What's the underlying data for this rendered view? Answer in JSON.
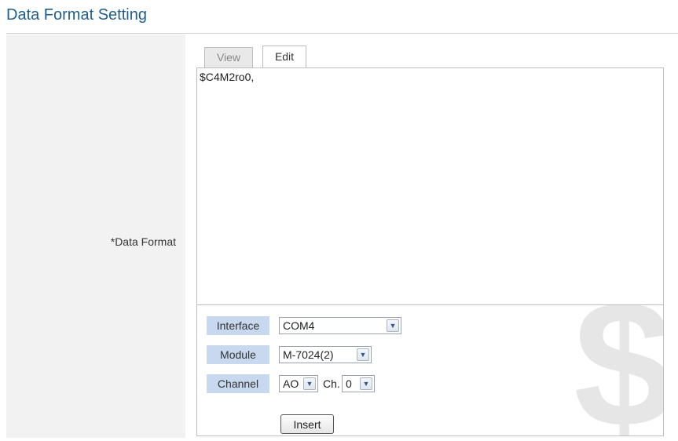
{
  "page": {
    "title": "Data Format Setting"
  },
  "row": {
    "label": "*Data Format"
  },
  "tabs": [
    {
      "label": "View",
      "active": false
    },
    {
      "label": "Edit",
      "active": true
    }
  ],
  "editor": {
    "value": "$C4M2ro0,"
  },
  "form": {
    "interface": {
      "label": "Interface",
      "value": "COM4"
    },
    "module": {
      "label": "Module",
      "value": "M-7024(2)"
    },
    "channel": {
      "label": "Channel",
      "type_value": "AO",
      "ch_label": "Ch.",
      "ch_value": "0"
    },
    "insert_label": "Insert"
  },
  "colors": {
    "title": "#1f5e8a",
    "field_label_bg": "#c8d8ee",
    "label_col_bg": "#f2f2f2"
  },
  "watermark": {
    "icon": "dollar-icon"
  }
}
